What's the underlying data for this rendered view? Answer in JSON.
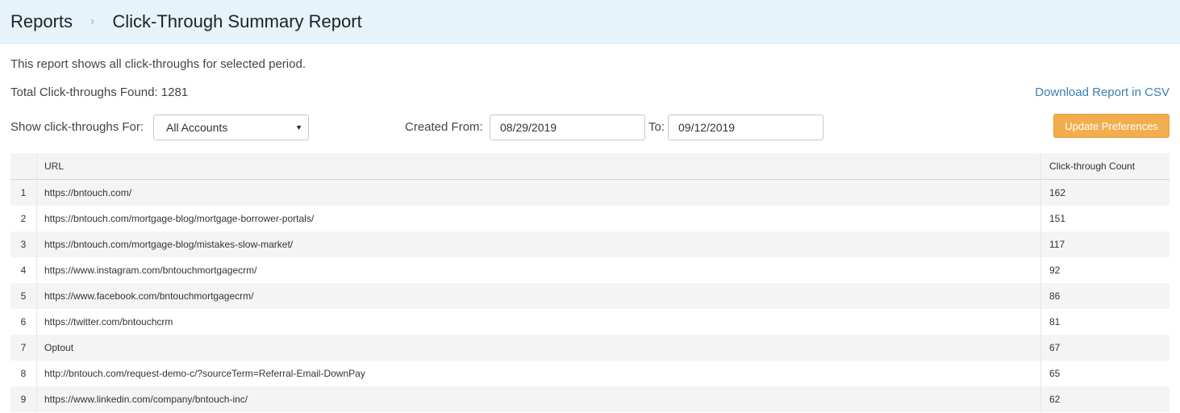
{
  "breadcrumb": {
    "root": "Reports",
    "separator": "›",
    "current": "Click-Through Summary Report"
  },
  "description": "This report shows all click-throughs for selected period.",
  "total": {
    "label": "Total Click-throughs Found: 1281"
  },
  "download_link": "Download Report in CSV",
  "filters": {
    "show_for_label": "Show click-throughs For:",
    "account_select_value": "All Accounts",
    "created_from_label": "Created From:",
    "from_date": "08/29/2019",
    "to_label": "To:",
    "to_date": "09/12/2019",
    "update_button": "Update Preferences"
  },
  "table": {
    "headers": {
      "num": "",
      "url": "URL",
      "count": "Click-through Count"
    },
    "rows": [
      {
        "num": "1",
        "url": "https://bntouch.com/",
        "count": "162"
      },
      {
        "num": "2",
        "url": "https://bntouch.com/mortgage-blog/mortgage-borrower-portals/",
        "count": "151"
      },
      {
        "num": "3",
        "url": "https://bntouch.com/mortgage-blog/mistakes-slow-market/",
        "count": "117"
      },
      {
        "num": "4",
        "url": "https://www.instagram.com/bntouchmortgagecrm/",
        "count": "92"
      },
      {
        "num": "5",
        "url": "https://www.facebook.com/bntouchmortgagecrm/",
        "count": "86"
      },
      {
        "num": "6",
        "url": "https://twitter.com/bntouchcrm",
        "count": "81"
      },
      {
        "num": "7",
        "url": "Optout",
        "count": "67"
      },
      {
        "num": "8",
        "url": "http://bntouch.com/request-demo-c/?sourceTerm=Referral-Email-DownPay",
        "count": "65"
      },
      {
        "num": "9",
        "url": "https://www.linkedin.com/company/bntouch-inc/",
        "count": "62"
      }
    ]
  },
  "colors": {
    "header_bg": "#e6f3fb",
    "link": "#3a7fb5",
    "button": "#f2ad4e"
  }
}
